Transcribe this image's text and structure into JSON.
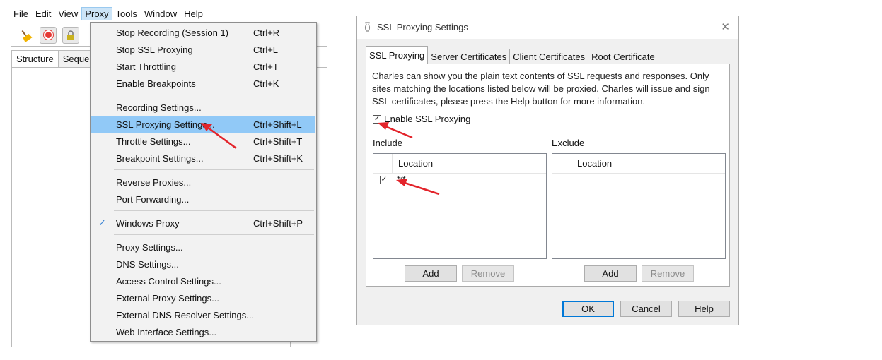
{
  "menubar": {
    "items": [
      "File",
      "Edit",
      "View",
      "Proxy",
      "Tools",
      "Window",
      "Help"
    ],
    "active_index": 3
  },
  "toolbar": {
    "icons": [
      "broom-icon",
      "record-icon",
      "ssl-lock-icon"
    ],
    "record_color": "#e53935"
  },
  "left_tabs": [
    "Structure",
    "Seque"
  ],
  "proxy_menu": {
    "items": [
      {
        "label": "Stop Recording (Session 1)",
        "shortcut": "Ctrl+R"
      },
      {
        "label": "Stop SSL Proxying",
        "shortcut": "Ctrl+L"
      },
      {
        "label": "Start Throttling",
        "shortcut": "Ctrl+T"
      },
      {
        "label": "Enable Breakpoints",
        "shortcut": "Ctrl+K"
      },
      {
        "label": "Recording Settings...",
        "shortcut": ""
      },
      {
        "label": "SSL Proxying Settings...",
        "shortcut": "Ctrl+Shift+L",
        "highlighted": true
      },
      {
        "label": "Throttle Settings...",
        "shortcut": "Ctrl+Shift+T"
      },
      {
        "label": "Breakpoint Settings...",
        "shortcut": "Ctrl+Shift+K"
      },
      {
        "label": "Reverse Proxies...",
        "shortcut": ""
      },
      {
        "label": "Port Forwarding...",
        "shortcut": ""
      },
      {
        "label": "Windows Proxy",
        "shortcut": "Ctrl+Shift+P",
        "checked": true
      },
      {
        "label": "Proxy Settings...",
        "shortcut": ""
      },
      {
        "label": "DNS Settings...",
        "shortcut": ""
      },
      {
        "label": "Access Control Settings...",
        "shortcut": ""
      },
      {
        "label": "External Proxy Settings...",
        "shortcut": ""
      },
      {
        "label": "External DNS Resolver Settings...",
        "shortcut": ""
      },
      {
        "label": "Web Interface Settings...",
        "shortcut": ""
      }
    ],
    "highlight_color": "#91c9f7"
  },
  "dialog": {
    "title": "SSL Proxying Settings",
    "close_glyph": "✕",
    "tabs": [
      "SSL Proxying",
      "Server Certificates",
      "Client Certificates",
      "Root Certificate"
    ],
    "selected_tab": 0,
    "description": "Charles can show you the plain text contents of SSL requests and responses. Only sites matching the locations listed below will be proxied. Charles will issue and sign SSL certificates, please press the Help button for more information.",
    "enable_label": "Enable SSL Proxying",
    "enable_checked": true,
    "include": {
      "label": "Include",
      "column": "Location",
      "rows": [
        {
          "checked": true,
          "value": "*:*"
        }
      ],
      "add_label": "Add",
      "remove_label": "Remove"
    },
    "exclude": {
      "label": "Exclude",
      "column": "Location",
      "rows": [],
      "add_label": "Add",
      "remove_label": "Remove"
    },
    "ok_label": "OK",
    "cancel_label": "Cancel",
    "help_label": "Help"
  },
  "annotation_color": "#e3242b"
}
